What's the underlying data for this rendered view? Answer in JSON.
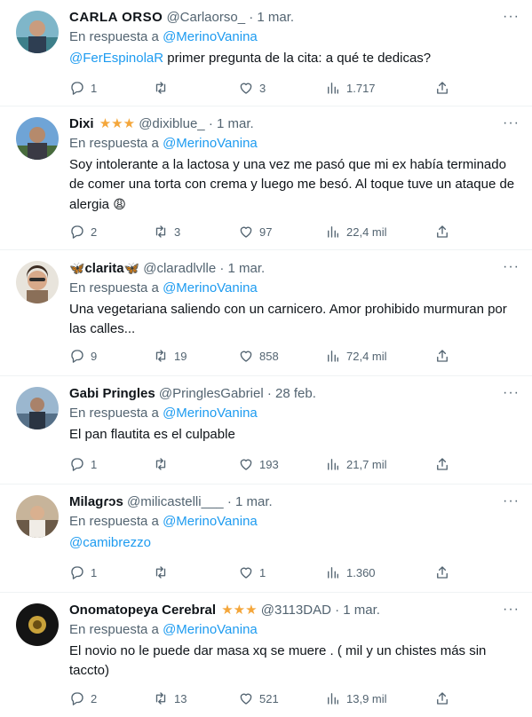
{
  "reply_prefix": "En respuesta a",
  "tweets": [
    {
      "display_name": "CARLA ORSO",
      "handle": "@Carlaorso_",
      "dot": "·",
      "date": "1 mar.",
      "reply_to": "@MerinoVanina",
      "mention": "@FerEspinolaR",
      "text": " primer pregunta de la cita: a qué te dedicas?",
      "replies": "1",
      "retweets": "",
      "likes": "3",
      "views": "1.717"
    },
    {
      "display_name": "Dixi",
      "stars": "★★★",
      "handle": "@dixiblue_",
      "dot": "·",
      "date": "1 mar.",
      "reply_to": "@MerinoVanina",
      "text": "Soy intolerante a la lactosa y una vez me pasó que mi ex había terminado de comer una torta con crema y luego me besó. Al toque tuve un ataque de alergia ",
      "emoji": "😩",
      "replies": "2",
      "retweets": "3",
      "likes": "97",
      "views": "22,4 mil"
    },
    {
      "display_name": "clarita",
      "butterfly": "🦋",
      "handle": "@claradlvlle",
      "dot": "·",
      "date": "1 mar.",
      "reply_to": "@MerinoVanina",
      "text": "Una vegetariana saliendo con un carnicero. Amor prohibido murmuran por las calles...",
      "replies": "9",
      "retweets": "19",
      "likes": "858",
      "views": "72,4 mil"
    },
    {
      "display_name": "Gabi Pringles",
      "handle": "@PringlesGabriel",
      "dot": "·",
      "date": "28 feb.",
      "reply_to": "@MerinoVanina",
      "text": "El pan flautita es el culpable",
      "replies": "1",
      "retweets": "",
      "likes": "193",
      "views": "21,7 mil"
    },
    {
      "display_name": "Milagɾɔs",
      "handle": "@milicastelli___",
      "dot": "·",
      "date": "1 mar.",
      "reply_to": "@MerinoVanina",
      "mention": "@camibrezzo",
      "replies": "1",
      "retweets": "",
      "likes": "1",
      "views": "1.360"
    },
    {
      "display_name": "Onomatopeya Cerebral",
      "stars": "★★★",
      "handle": "@3113DAD",
      "dot": "·",
      "date": "1 mar.",
      "reply_to": "@MerinoVanina",
      "text": "El novio no le puede dar masa xq se muere . ( mil y un chistes más sin taccto)",
      "replies": "2",
      "retweets": "13",
      "likes": "521",
      "views": "13,9 mil"
    }
  ],
  "icons": {
    "more": "more-icon",
    "reply": "reply-icon",
    "retweet": "retweet-icon",
    "like": "like-icon",
    "views": "views-icon",
    "share": "share-icon"
  },
  "colors": {
    "link": "#1d9bf0",
    "secondary_text": "#536471",
    "star": "#f4a63a"
  }
}
